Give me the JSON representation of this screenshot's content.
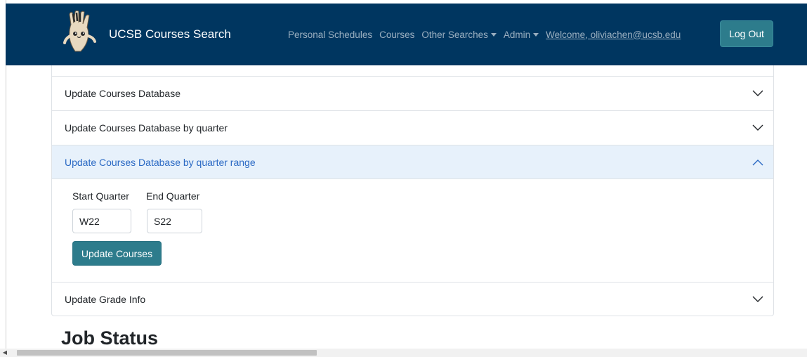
{
  "navbar": {
    "brand": "UCSB Courses Search",
    "links": {
      "personal_schedules": "Personal Schedules",
      "courses": "Courses",
      "other_searches": "Other Searches",
      "admin": "Admin"
    },
    "welcome": "Welcome, oliviachen@ucsb.edu",
    "logout": "Log Out",
    "bg_color": "#003660"
  },
  "accordion": {
    "items": [
      {
        "label": "Update Courses Database",
        "expanded": false
      },
      {
        "label": "Update Courses Database by quarter",
        "expanded": false
      },
      {
        "label": "Update Courses Database by quarter range",
        "expanded": true
      },
      {
        "label": "Update Grade Info",
        "expanded": false
      }
    ],
    "range_form": {
      "start_label": "Start Quarter",
      "end_label": "End Quarter",
      "start_value": "W22",
      "end_value": "S22",
      "submit": "Update Courses"
    }
  },
  "section_title": "Job Status",
  "colors": {
    "accent": "#2d7c8c",
    "active_header_bg": "#e7f1fb",
    "active_header_text": "#2a69c4"
  }
}
